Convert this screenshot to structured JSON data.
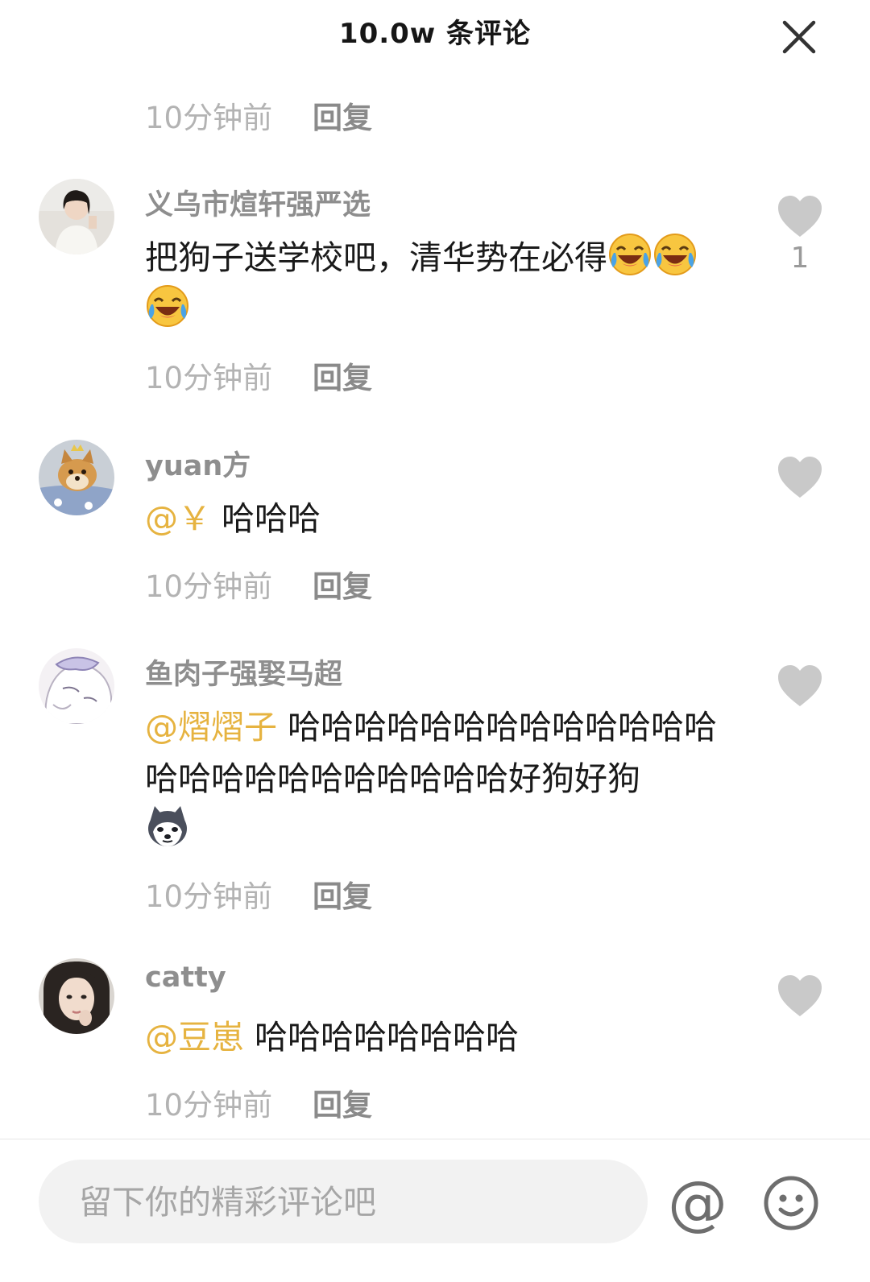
{
  "header": {
    "title": "10.0w 条评论"
  },
  "top_meta": {
    "time": "10分钟前",
    "reply": "回复"
  },
  "comments": [
    {
      "username": "义乌市煊轩强严选",
      "text": "把狗子送学校吧，清华势在必得",
      "emojis": [
        "laugh-cry-emoji",
        "laugh-cry-emoji",
        "laugh-cry-emoji"
      ],
      "like_count": "1",
      "time": "10分钟前",
      "reply": "回复"
    },
    {
      "username": "yuan方",
      "mention": "@￥",
      "text": "哈哈哈",
      "time": "10分钟前",
      "reply": "回复"
    },
    {
      "username": "鱼肉子强娶马超",
      "mention": "@熠熠子",
      "text": "哈哈哈哈哈哈哈哈哈哈哈哈哈哈哈哈哈哈哈哈哈哈哈哈好狗好狗",
      "emojis": [
        "husky-dog-emoji"
      ],
      "time": "10分钟前",
      "reply": "回复"
    },
    {
      "username": "catty",
      "mention": "@豆崽",
      "text": "哈哈哈哈哈哈哈哈",
      "time": "10分钟前",
      "reply": "回复"
    }
  ],
  "input": {
    "placeholder": "留下你的精彩评论吧"
  },
  "toolbar": {
    "at_label": "@"
  },
  "colors": {
    "mention": "#e6b340",
    "heart": "#c9c9c9",
    "meta_text": "#b3b3b3",
    "username": "#8e8e8e"
  }
}
